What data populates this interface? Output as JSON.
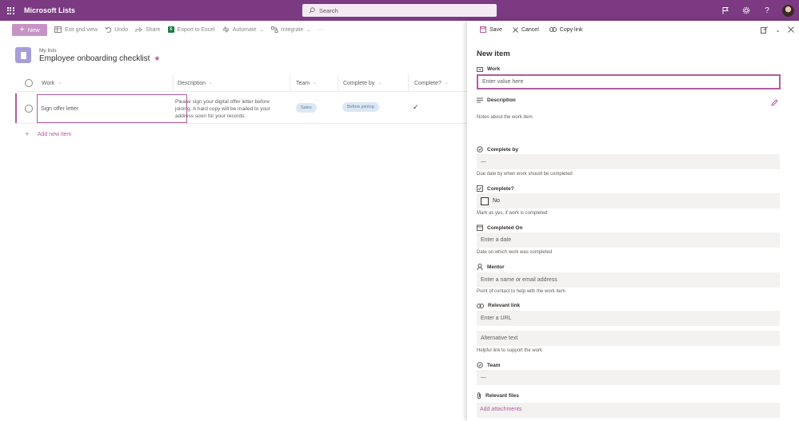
{
  "appbar": {
    "app_title": "Microsoft Lists",
    "search_placeholder": "Search",
    "icons": [
      "waffle-icon",
      "search-icon",
      "flag-icon",
      "gear-icon",
      "help-icon",
      "avatar"
    ]
  },
  "commandbar": {
    "new_label": "New",
    "exit_grid_label": "Exit grid view",
    "undo_label": "Undo",
    "share_label": "Share",
    "export_label": "Export to Excel",
    "automate_label": "Automate",
    "integrate_label": "Integrate",
    "more_label": "···"
  },
  "header": {
    "breadcrumb": "My lists",
    "title": "Employee onboarding checklist",
    "star": "★"
  },
  "grid": {
    "columns": [
      "Work",
      "Description",
      "Team",
      "Complete by",
      "Complete?"
    ],
    "rows": [
      {
        "work": "Sign offer letter",
        "description": "Please sign your digital offer letter before joining. A hard copy will be mailed to your address soon for your records.",
        "team": "Sales",
        "complete_by": "Before joining",
        "complete": "✓"
      }
    ],
    "add_new_label": "Add new item"
  },
  "panel": {
    "save_label": "Save",
    "cancel_label": "Cancel",
    "copy_link_label": "Copy link",
    "title": "New item",
    "fields": {
      "work": {
        "label": "Work",
        "placeholder": "Enter value here"
      },
      "description": {
        "label": "Description",
        "help": "Notes about the work item"
      },
      "complete_by": {
        "label": "Complete by",
        "value": "—",
        "help": "Due date by when work should be completed"
      },
      "complete": {
        "label": "Complete?",
        "value": "No",
        "help": "Mark as yes, if work is completed"
      },
      "completed_on": {
        "label": "Completed On",
        "placeholder": "Enter a date",
        "help": "Date on which work was completed"
      },
      "mentor": {
        "label": "Mentor",
        "placeholder": "Enter a name or email address",
        "help": "Point of contact to help with the work item"
      },
      "relevant_link": {
        "label": "Relevant link",
        "url_placeholder": "Enter a URL",
        "alt_placeholder": "Alternative text",
        "help": "Helpful link to support the work"
      },
      "team": {
        "label": "Team",
        "value": "—"
      },
      "relevant_files": {
        "label": "Relevant files",
        "link": "Add attachments"
      }
    }
  },
  "colors": {
    "brand": "#7b3a82",
    "accent": "#b25c9e",
    "new_button": "#c793c5"
  }
}
